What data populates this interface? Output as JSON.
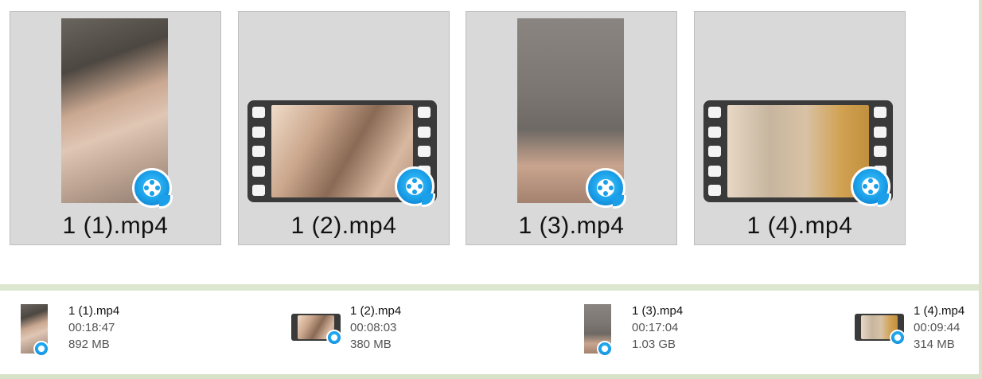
{
  "colors": {
    "tile_bg": "#d9d9d9",
    "badge_blue": "#1a9fe8",
    "frame_green": "#d8e2c8"
  },
  "icon_view": {
    "items": [
      {
        "label": "1 (1).mp4",
        "thumb": "portrait",
        "badge_icon": "video-player-app-icon"
      },
      {
        "label": "1 (2).mp4",
        "thumb": "landscape",
        "badge_icon": "video-player-app-icon"
      },
      {
        "label": "1 (3).mp4",
        "thumb": "portrait",
        "badge_icon": "video-player-app-icon"
      },
      {
        "label": "1 (4).mp4",
        "thumb": "landscape",
        "badge_icon": "video-player-app-icon"
      }
    ]
  },
  "details_view": {
    "items": [
      {
        "name": "1 (1).mp4",
        "duration": "00:18:47",
        "size": "892 MB"
      },
      {
        "name": "1 (2).mp4",
        "duration": "00:08:03",
        "size": "380 MB"
      },
      {
        "name": "1 (3).mp4",
        "duration": "00:17:04",
        "size": "1.03 GB"
      },
      {
        "name": "1 (4).mp4",
        "duration": "00:09:44",
        "size": "314 MB"
      }
    ]
  }
}
